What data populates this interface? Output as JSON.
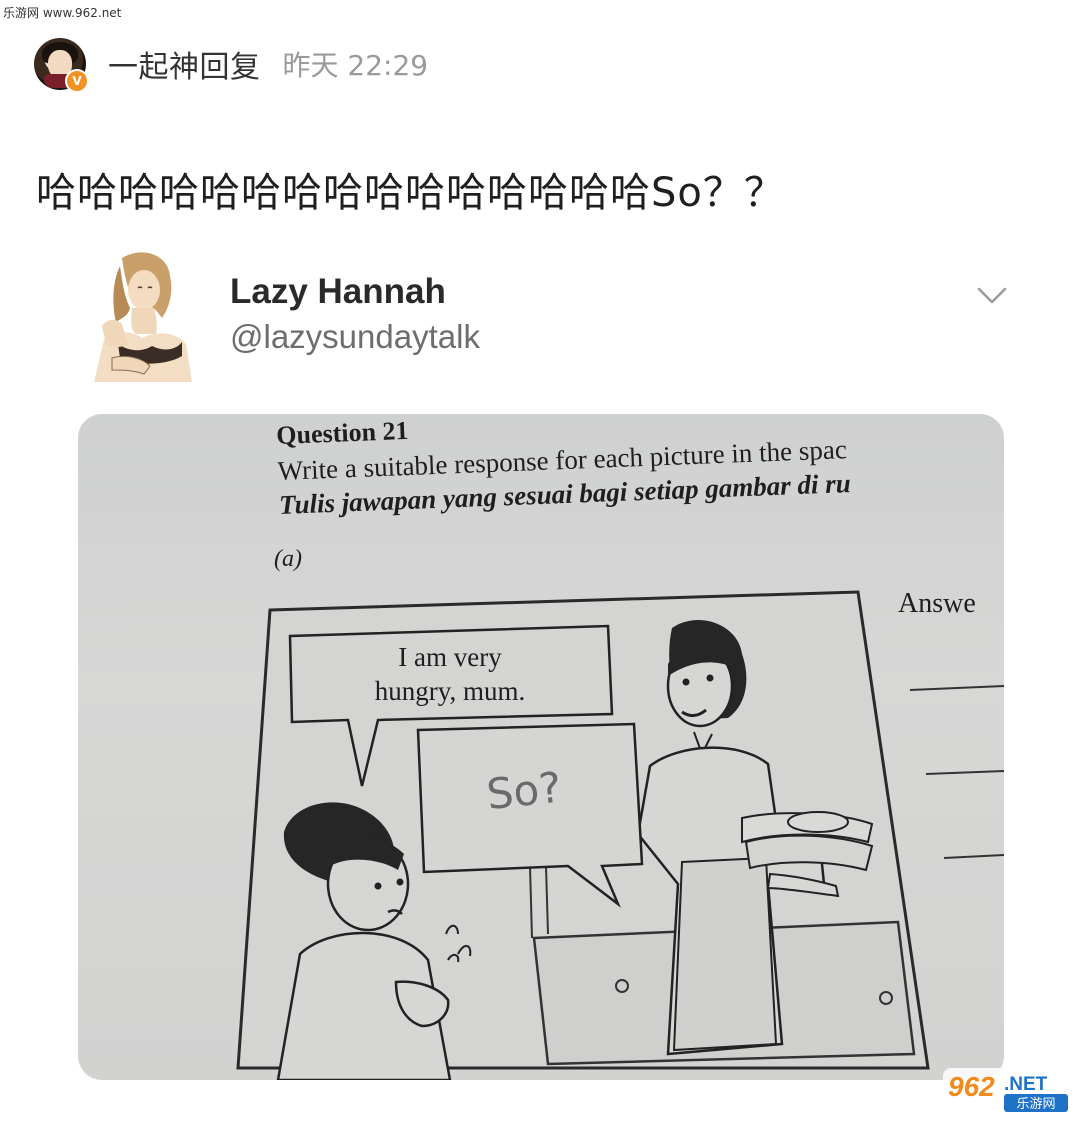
{
  "watermark_top": "乐游网 www.962.net",
  "post": {
    "username": "一起神回复",
    "verified_badge": "V",
    "timestamp": "昨天 22:29",
    "text": "哈哈哈哈哈哈哈哈哈哈哈哈哈哈哈So？？"
  },
  "tweet": {
    "name": "Lazy Hannah",
    "handle": "@lazysundaytalk",
    "photo": {
      "question": "Question 21",
      "line1": "Write a suitable response for each picture in the spac",
      "line2": "Tulis jawapan yang sesuai bagi setiap gambar di ru",
      "part": "(a)",
      "answer_label": "Answe",
      "bubble_boy_line1": "I am very",
      "bubble_boy_line2": "hungry, mum.",
      "bubble_mum": "So?"
    }
  },
  "watermark_logo": {
    "big": "962",
    "suffix": ".NET",
    "sub": "乐游网"
  },
  "colors": {
    "badge": "#f29222",
    "timestamp": "#9a9a9a",
    "handle": "#6d6d6d",
    "logo_orange": "#f28a1c",
    "logo_blue": "#1e73c8"
  },
  "icons": [
    "verified-badge-icon",
    "chevron-down-icon"
  ]
}
